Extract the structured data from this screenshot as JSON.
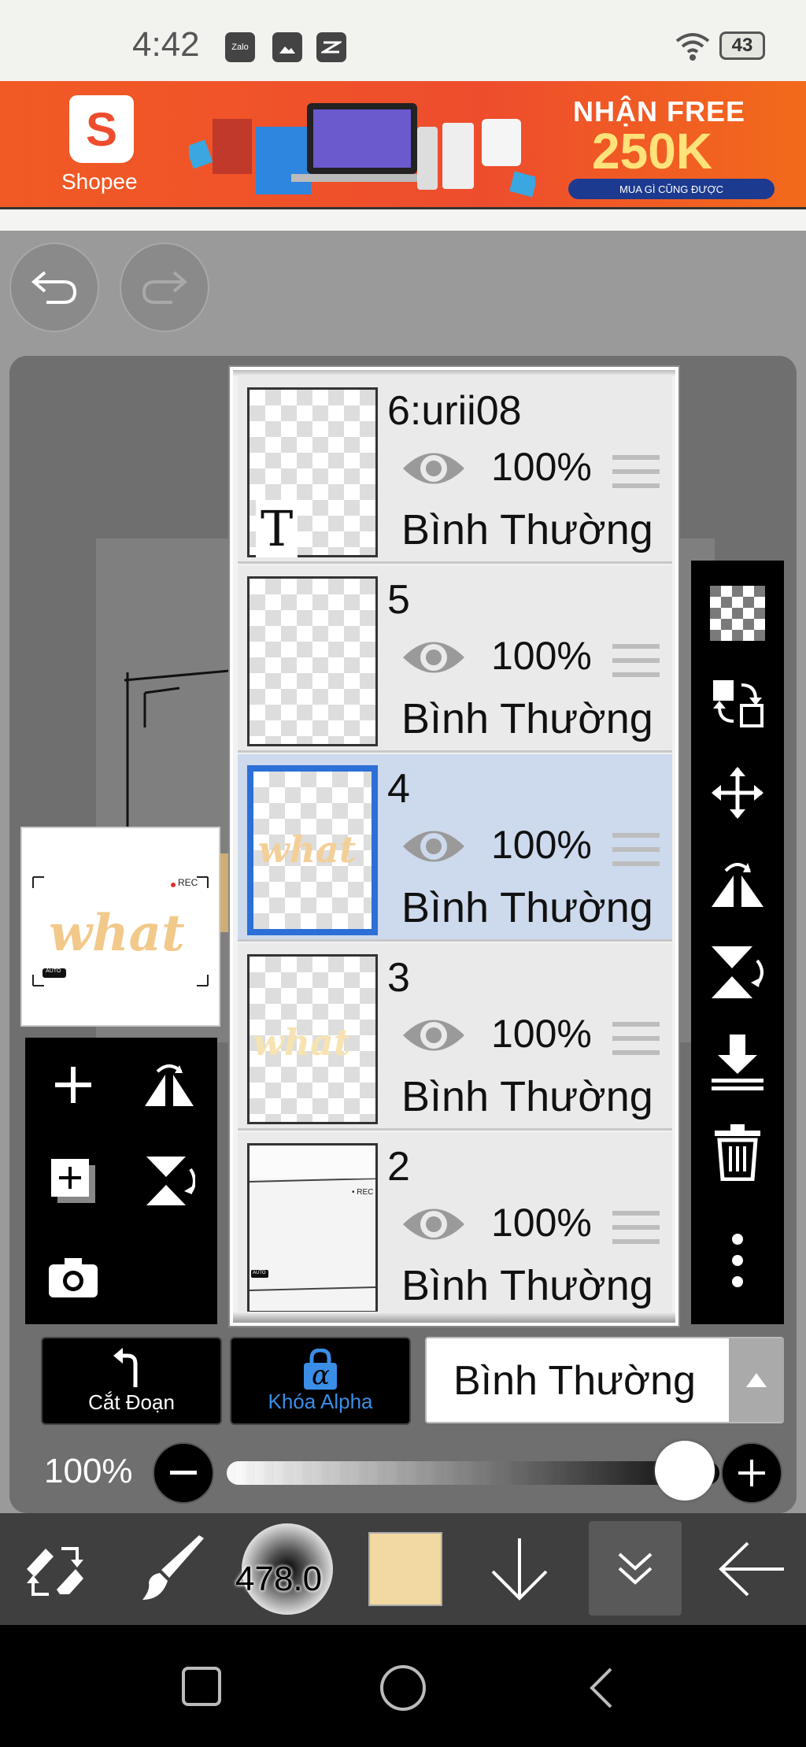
{
  "status_bar": {
    "time": "4:42",
    "icons": [
      "zalo-icon",
      "gallery-icon",
      "capcut-icon"
    ],
    "zalo_text": "Zalo",
    "battery": "43"
  },
  "ad_banner": {
    "brand": "Shopee",
    "logo_letter": "S",
    "promo_line1": "NHẬN FREE",
    "promo_line2": "250K",
    "promo_pill": "MUA GÌ CŨNG ĐƯỢC"
  },
  "history": {
    "undo_icon": "undo-icon",
    "redo_icon": "redo-icon"
  },
  "thumbnail": {
    "text": "what",
    "rec_label": "REC",
    "auto_label": "AUTO"
  },
  "layers": [
    {
      "name": "6:urii08",
      "opacity": "100%",
      "blend": "Bình Thường",
      "thumb_glyph": "T",
      "selected": false
    },
    {
      "name": "5",
      "opacity": "100%",
      "blend": "Bình Thường",
      "selected": false
    },
    {
      "name": "4",
      "opacity": "100%",
      "blend": "Bình Thường",
      "thumb_text": "what",
      "selected": true
    },
    {
      "name": "3",
      "opacity": "100%",
      "blend": "Bình Thường",
      "thumb_text": "what",
      "selected": false
    },
    {
      "name": "2",
      "opacity": "100%",
      "blend": "Bình Thường",
      "thumb_rec": "• REC",
      "thumb_auto": "AUTO",
      "selected": false
    }
  ],
  "left_tools": [
    "add-layer-icon",
    "flip-horizontal-icon",
    "add-copy-icon",
    "flip-vertical-icon",
    "camera-icon"
  ],
  "right_tools": [
    "transparency-icon",
    "swap-layer-icon",
    "move-icon",
    "rotate-flip-horizontal-icon",
    "rotate-flip-vertical-icon",
    "merge-down-icon",
    "trash-icon",
    "more-icon"
  ],
  "bottom_controls": {
    "clipping_label": "Cắt Đoạn",
    "alpha_lock_label": "Khóa Alpha",
    "alpha_glyph": "α",
    "blend_mode": "Bình Thường",
    "opacity": "100%"
  },
  "toolbar": {
    "brush_size": "478.0"
  },
  "colors": {
    "accent_blue": "#2c6fd6",
    "selected_layer_bg": "#cdd9ec",
    "current_color": "#f2d9a2",
    "alpha_lock_blue": "#3a8ee6"
  }
}
